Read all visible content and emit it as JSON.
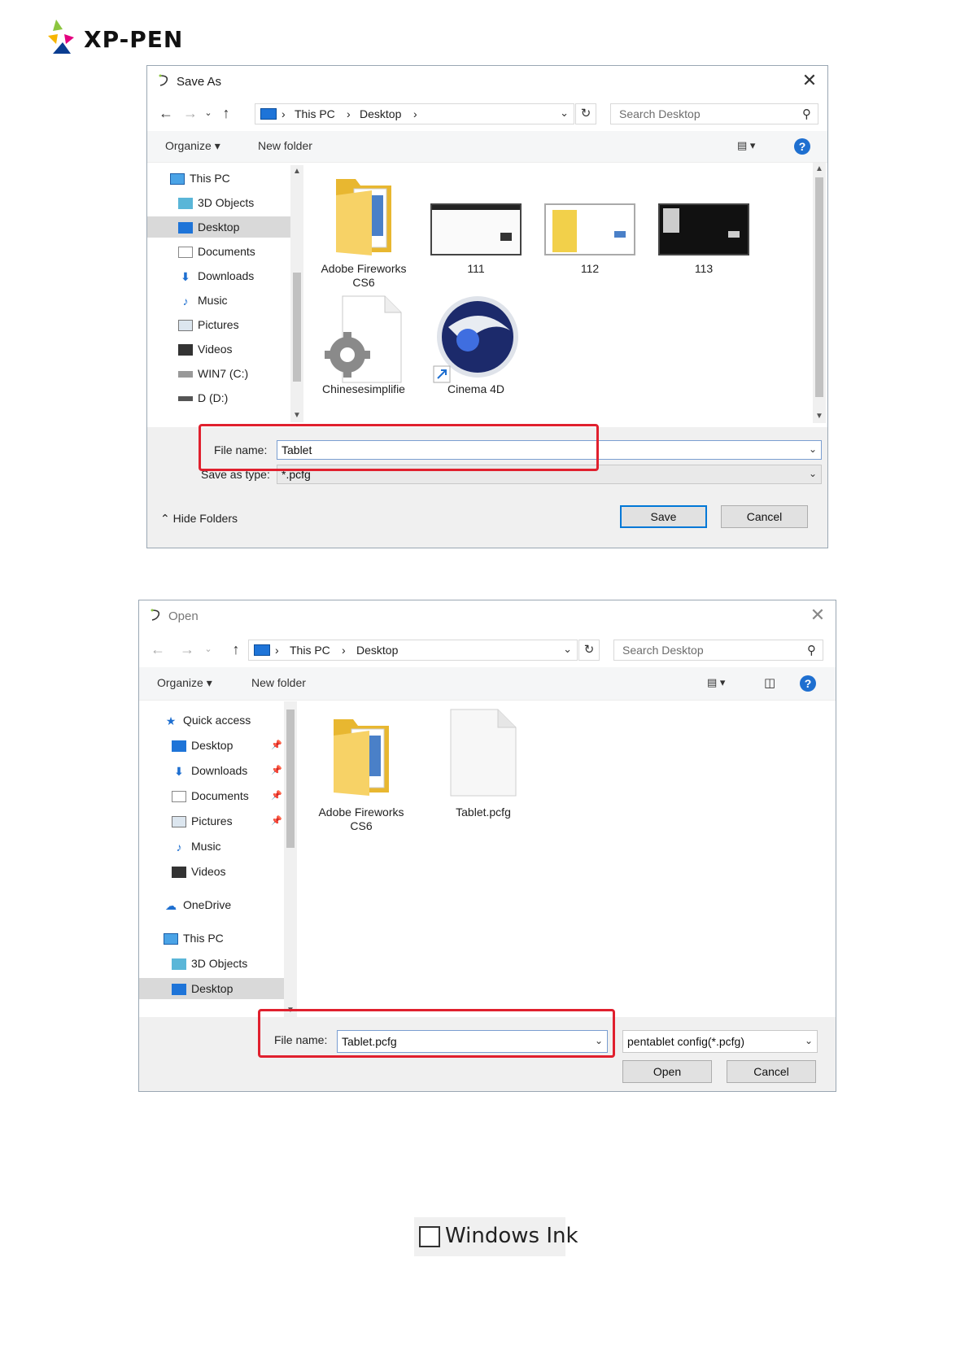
{
  "brand": {
    "name": "XP-PEN"
  },
  "save_dialog": {
    "title": "Save As",
    "breadcrumb": [
      "This PC",
      "Desktop"
    ],
    "search_placeholder": "Search Desktop",
    "toolbar": {
      "organize": "Organize",
      "new_folder": "New folder"
    },
    "nav": [
      "This PC",
      "3D Objects",
      "Desktop",
      "Documents",
      "Downloads",
      "Music",
      "Pictures",
      "Videos",
      "WIN7 (C:)",
      "D (D:)"
    ],
    "files": [
      {
        "name": "Adobe Fireworks CS6",
        "line1": "Adobe Fireworks",
        "line2": "CS6"
      },
      {
        "name": "111"
      },
      {
        "name": "112"
      },
      {
        "name": "113"
      },
      {
        "name": "Chinesesimplifie"
      },
      {
        "name": "Cinema 4D"
      }
    ],
    "file_name_label": "File name:",
    "file_name_value": "Tablet",
    "save_type_label": "Save as type:",
    "save_type_value": "*.pcfg",
    "hide_folders": "Hide Folders",
    "save_button": "Save",
    "cancel_button": "Cancel"
  },
  "open_dialog": {
    "title": "Open",
    "breadcrumb": [
      "This PC",
      "Desktop"
    ],
    "search_placeholder": "Search Desktop",
    "toolbar": {
      "organize": "Organize",
      "new_folder": "New folder"
    },
    "nav": [
      "Quick access",
      "Desktop",
      "Downloads",
      "Documents",
      "Pictures",
      "Music",
      "Videos",
      "OneDrive",
      "This PC",
      "3D Objects",
      "Desktop"
    ],
    "files": [
      {
        "name": "Adobe Fireworks CS6",
        "line1": "Adobe Fireworks",
        "line2": "CS6"
      },
      {
        "name": "Tablet.pcfg"
      }
    ],
    "file_name_label": "File name:",
    "file_name_value": "Tablet.pcfg",
    "file_type_value": "pentablet config(*.pcfg)",
    "open_button": "Open",
    "cancel_button": "Cancel"
  },
  "checkbox": {
    "label": "Windows Ink",
    "checked": false
  },
  "colors": {
    "highlight_box": "#e0202e",
    "accent": "#0078d7",
    "help": "#1e6fd0"
  }
}
